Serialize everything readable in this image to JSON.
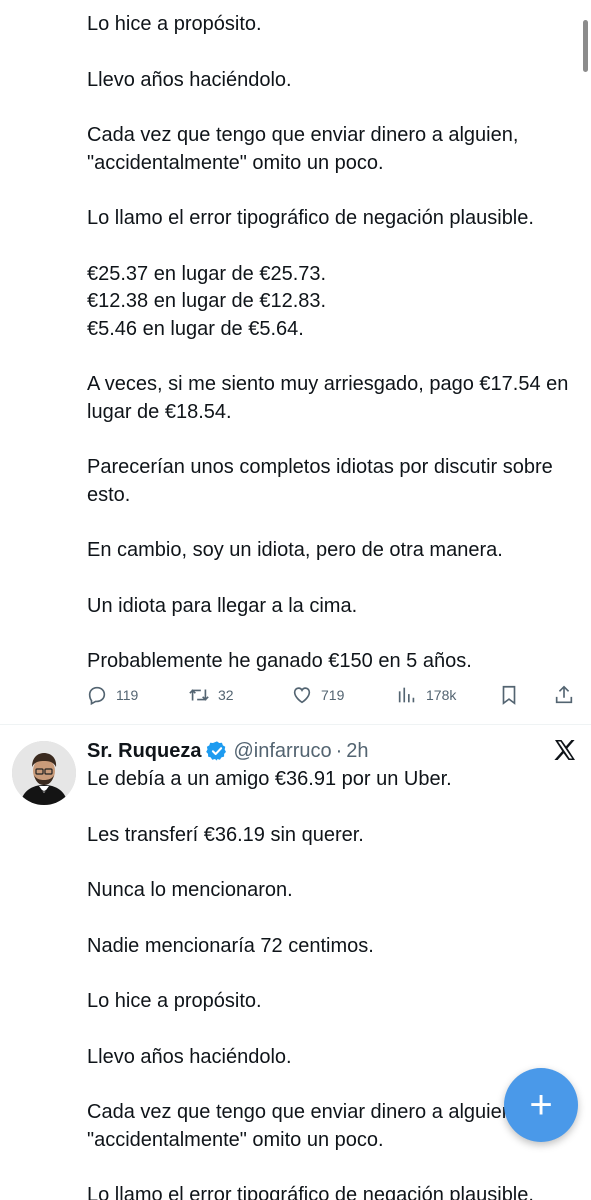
{
  "top_tweet": {
    "paragraphs": [
      "Lo hice a propósito.",
      "Llevo años haciéndolo.",
      "Cada vez que tengo que enviar dinero a alguien, \"accidentalmente\" omito un poco.",
      "Lo llamo el error tipográfico de negación plausible.",
      "€25.37 en lugar de €25.73.\n€12.38 en lugar de €12.83.\n€5.46 en lugar de €5.64.",
      "A veces, si me siento muy arriesgado, pago €17.54 en lugar de €18.54.",
      "Parecerían unos completos idiotas por discutir sobre esto.",
      "En cambio, soy un idiota, pero de otra manera.",
      "Un idiota para llegar a la cima.",
      "Probablemente he ganado €150 en 5 años."
    ],
    "actions": {
      "replies": "119",
      "retweets": "32",
      "likes": "719",
      "views": "178k"
    }
  },
  "bottom_tweet": {
    "author_name": "Sr. Ruqueza",
    "handle": "@infarruco",
    "dot": "·",
    "time": "2h",
    "paragraphs": [
      "Le debía a un amigo €36.91 por un Uber.",
      "Les transferí €36.19 sin querer.",
      "Nunca lo mencionaron.",
      "Nadie mencionaría 72 centimos.",
      "Lo hice a propósito.",
      "Llevo años haciéndolo.",
      "Cada vez que tengo que enviar dinero a alguien, \"accidentalmente\" omito un poco.",
      "Lo llamo el error tipográfico de negación plausible."
    ]
  },
  "icons": {
    "reply": "reply-icon",
    "retweet": "retweet-icon",
    "like": "heart-icon",
    "views": "views-icon",
    "bookmark": "bookmark-icon",
    "share": "share-icon",
    "verified": "verified-badge-icon",
    "x_logo": "x-logo-icon",
    "compose": "plus-icon"
  },
  "colors": {
    "text": "#0f1419",
    "secondary": "#536471",
    "accent": "#1d9bf0",
    "fab": "#4a99e9"
  }
}
